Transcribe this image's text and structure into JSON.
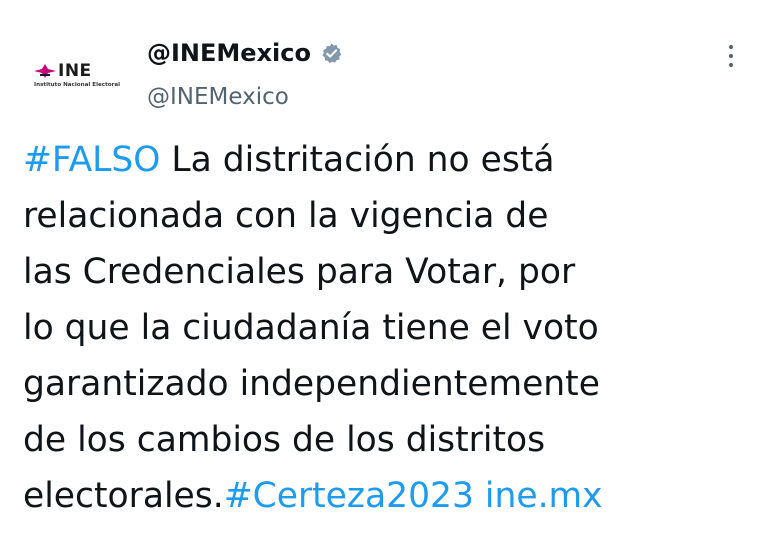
{
  "author": {
    "display_name": "@INEMexico",
    "handle": "@INEMexico",
    "verified": true,
    "avatar": {
      "logo_text": "INE",
      "logo_subtitle": "Instituto Nacional Electoral"
    }
  },
  "menu": {
    "icon": "more-vertical-icon"
  },
  "tweet": {
    "lines": [
      {
        "hashtag": "#FALSO",
        "text": " La distritación no está"
      },
      {
        "text": "relacionada con la vigencia de"
      },
      {
        "text": "las Credenciales para Votar, por"
      },
      {
        "text": "lo que la ciudadanía tiene el voto"
      },
      {
        "text": "garantizado independientemente"
      },
      {
        "text": "de los cambios de los distritos"
      },
      {
        "text": "electorales.",
        "hashtag": "#Certeza2023",
        "link": " ine.mx"
      }
    ]
  },
  "colors": {
    "text": "#0f1419",
    "secondary": "#536471",
    "accent": "#1d9bf0",
    "logo_magenta": "#c6007e"
  }
}
